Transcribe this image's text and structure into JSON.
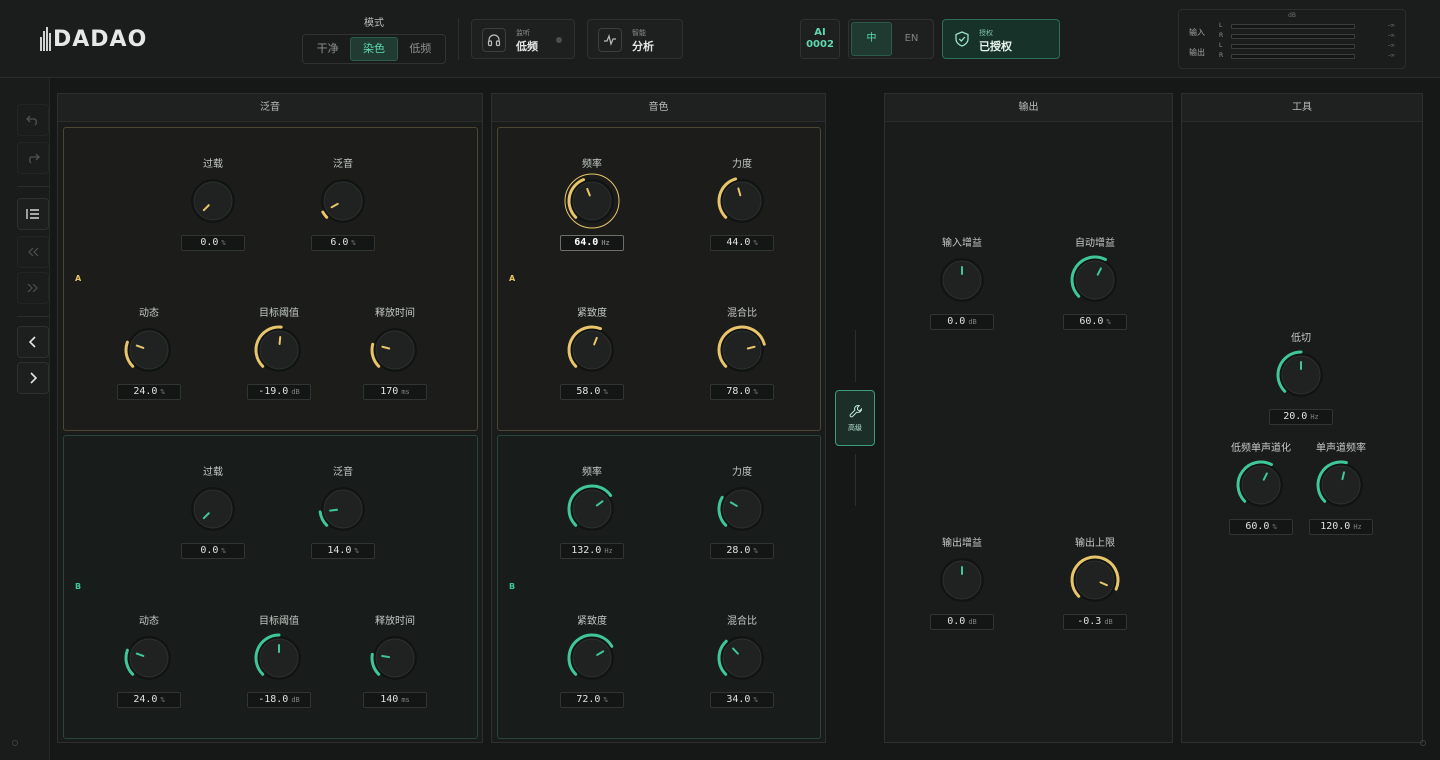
{
  "app": {
    "logo_text": "DADAO"
  },
  "header": {
    "mode_title": "模式",
    "modes": [
      {
        "label": "干净",
        "active": false
      },
      {
        "label": "染色",
        "active": true
      },
      {
        "label": "低频",
        "active": false
      }
    ],
    "monitor": {
      "small": "监听",
      "big": "低频",
      "icon": "headphones-icon"
    },
    "smart": {
      "small": "智能",
      "big": "分析",
      "icon": "waveform-icon"
    },
    "ai": {
      "line1": "AI",
      "line2": "0002"
    },
    "lang": [
      {
        "label": "中",
        "active": true
      },
      {
        "label": "EN",
        "active": false
      }
    ],
    "license": {
      "small": "授权",
      "big": "已授权",
      "icon": "shield-check-icon"
    }
  },
  "meters": {
    "unit": "dB",
    "input_label": "输入",
    "output_label": "输出",
    "channels": [
      {
        "ch": "L",
        "value": "-∞"
      },
      {
        "ch": "R",
        "value": "-∞"
      },
      {
        "ch": "L",
        "value": "-∞"
      },
      {
        "ch": "R",
        "value": "-∞"
      }
    ]
  },
  "colors": {
    "accent_teal": "#3fc79a",
    "accent_gold": "#e8c56a"
  },
  "panels": {
    "harmonic": {
      "title": "泛音"
    },
    "tone": {
      "title": "音色"
    },
    "output": {
      "title": "输出"
    },
    "tools": {
      "title": "工具"
    }
  },
  "harmonic": {
    "A": {
      "tag": "A",
      "knobs": [
        {
          "label": "过载",
          "value": "0.0",
          "unit": "%",
          "norm": 0.0
        },
        {
          "label": "泛音",
          "value": "6.0",
          "unit": "%",
          "norm": 0.06
        },
        {
          "label": "动态",
          "value": "24.0",
          "unit": "%",
          "norm": 0.24
        },
        {
          "label": "目标阈值",
          "value": "-19.0",
          "unit": "dB",
          "norm": 0.52
        },
        {
          "label": "释放时间",
          "value": "170",
          "unit": "ms",
          "norm": 0.22
        }
      ]
    },
    "B": {
      "tag": "B",
      "knobs": [
        {
          "label": "过载",
          "value": "0.0",
          "unit": "%",
          "norm": 0.0
        },
        {
          "label": "泛音",
          "value": "14.0",
          "unit": "%",
          "norm": 0.14
        },
        {
          "label": "动态",
          "value": "24.0",
          "unit": "%",
          "norm": 0.24
        },
        {
          "label": "目标阈值",
          "value": "-18.0",
          "unit": "dB",
          "norm": 0.5
        },
        {
          "label": "释放时间",
          "value": "140",
          "unit": "ms",
          "norm": 0.2
        }
      ]
    }
  },
  "tone": {
    "A": {
      "tag": "A",
      "knobs": [
        {
          "label": "频率",
          "value": "64.0",
          "unit": "Hz",
          "norm": 0.42,
          "selected": true
        },
        {
          "label": "力度",
          "value": "44.0",
          "unit": "%",
          "norm": 0.44
        },
        {
          "label": "紧致度",
          "value": "58.0",
          "unit": "%",
          "norm": 0.58
        },
        {
          "label": "混合比",
          "value": "78.0",
          "unit": "%",
          "norm": 0.78
        }
      ]
    },
    "B": {
      "tag": "B",
      "knobs": [
        {
          "label": "频率",
          "value": "132.0",
          "unit": "Hz",
          "norm": 0.7
        },
        {
          "label": "力度",
          "value": "28.0",
          "unit": "%",
          "norm": 0.28
        },
        {
          "label": "紧致度",
          "value": "72.0",
          "unit": "%",
          "norm": 0.72
        },
        {
          "label": "混合比",
          "value": "34.0",
          "unit": "%",
          "norm": 0.34
        }
      ]
    }
  },
  "advanced": {
    "label": "高级",
    "icon": "wrench-icon"
  },
  "output": {
    "knobs": [
      {
        "label": "输入增益",
        "value": "0.0",
        "unit": "dB",
        "norm": 0.5,
        "bipolar": true
      },
      {
        "label": "自动增益",
        "value": "60.0",
        "unit": "%",
        "norm": 0.6
      },
      {
        "label": "输出增益",
        "value": "0.0",
        "unit": "dB",
        "norm": 0.5,
        "bipolar": true
      },
      {
        "label": "输出上限",
        "value": "-0.3",
        "unit": "dB",
        "norm": 0.92
      }
    ]
  },
  "tools": {
    "knobs": [
      {
        "label": "低切",
        "value": "20.0",
        "unit": "Hz",
        "norm": 0.5
      },
      {
        "label": "低频单声道化",
        "value": "60.0",
        "unit": "%",
        "norm": 0.6
      },
      {
        "label": "单声道频率",
        "value": "120.0",
        "unit": "Hz",
        "norm": 0.55
      }
    ]
  }
}
